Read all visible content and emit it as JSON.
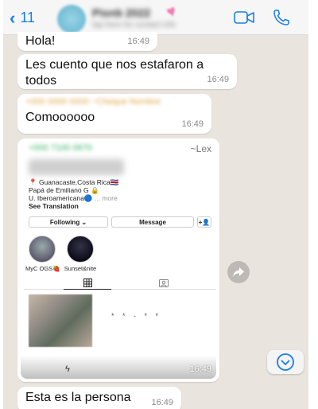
{
  "header": {
    "back_count": "11",
    "contact_name": "Pisnb 2022",
    "contact_subtitle": "tap here for contact info"
  },
  "messages": [
    {
      "text": "Hola!",
      "time": "16:49"
    },
    {
      "text": "Les cuento que nos estafaron a todos",
      "time": "16:49"
    },
    {
      "sender_blur": "+000 0000 0000 ~Cheque Nombre",
      "text": "Comoooooo",
      "time": "16:49"
    },
    {
      "text": "Esta es la persona",
      "time": "16:49"
    }
  ],
  "shared_card": {
    "sender": "+000 7100 0670",
    "sender_alias": "~Lex",
    "time": "16:49",
    "bio": {
      "line1": "📍 Guanacaste,Costa Rica🇨🇷",
      "line2": "Papá de Emiliano G 🔒",
      "line3": "U. Iberoamericana🔵 ",
      "more": "... more",
      "see_translation": "See Translation"
    },
    "buttons": {
      "following": "Following ⌄",
      "message": "Message",
      "add": "+👤"
    },
    "highlights": [
      {
        "label": "MyC OGS🍓"
      },
      {
        "label": "Sunset&nite"
      }
    ],
    "post_caption": "* * - * *",
    "flash": "ϟ"
  },
  "colors": {
    "accent": "#1a7ee6",
    "chat_bg": "#e9e4dd",
    "bubble": "#ffffff",
    "sender_green": "#34b364"
  }
}
